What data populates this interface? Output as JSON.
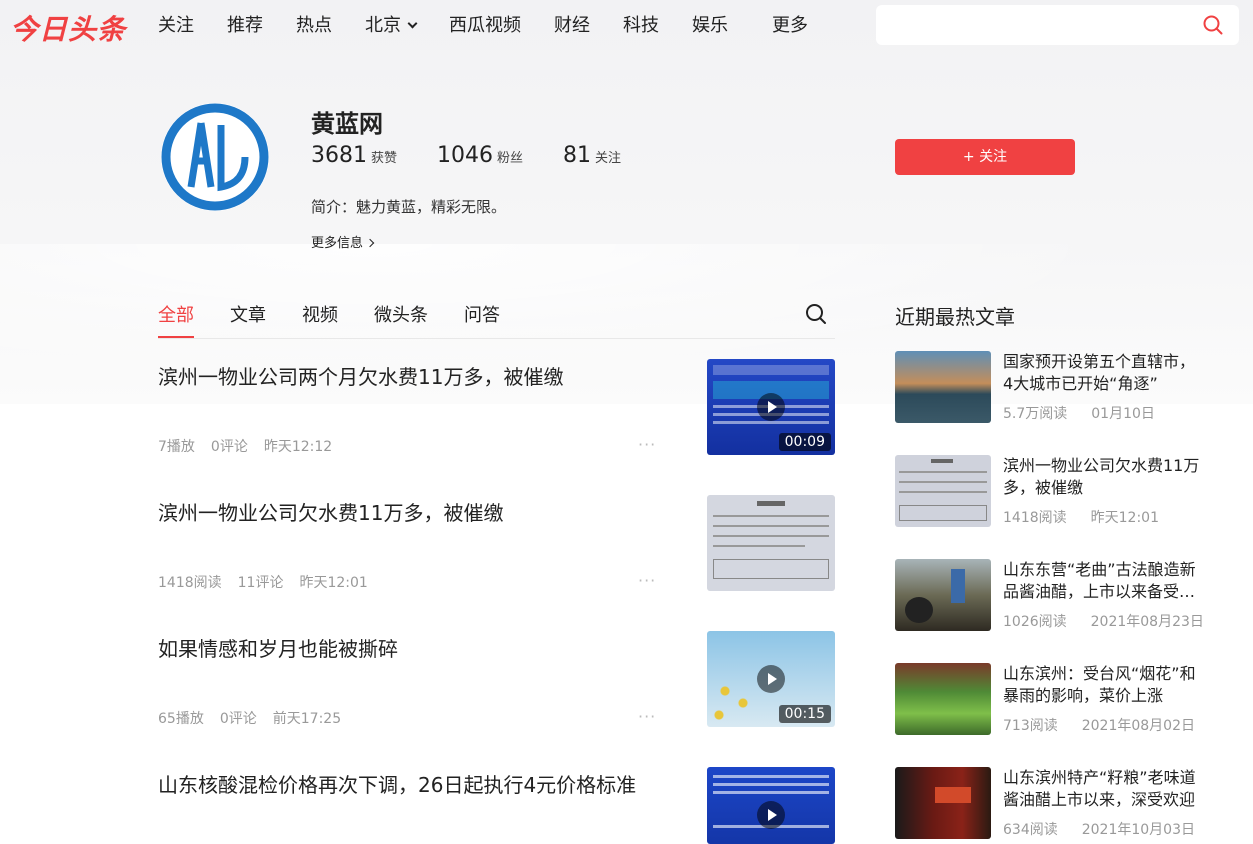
{
  "header": {
    "logo": "今日头条",
    "nav": [
      "关注",
      "推荐",
      "热点",
      "北京",
      "西瓜视频",
      "财经",
      "科技",
      "娱乐",
      "更多"
    ],
    "search_placeholder": ""
  },
  "profile": {
    "name": "黄蓝网",
    "stats": [
      {
        "value": "3681",
        "label": "获赞"
      },
      {
        "value": "1046",
        "label": "粉丝"
      },
      {
        "value": "81",
        "label": "关注"
      }
    ],
    "intro": "简介：魅力黄蓝，精彩无限。",
    "more_info": "更多信息",
    "follow_button": "+ 关注"
  },
  "tabs": [
    "全部",
    "文章",
    "视频",
    "微头条",
    "问答"
  ],
  "feed": [
    {
      "title": "滨州一物业公司两个月欠水费11万多，被催缴",
      "stat": "7播放",
      "comments": "0评论",
      "time": "昨天12:12",
      "duration": "00:09",
      "thumb_color": "#1c3fb5",
      "video": true
    },
    {
      "title": "滨州一物业公司欠水费11万多，被催缴",
      "stat": "1418阅读",
      "comments": "11评论",
      "time": "昨天12:01",
      "duration": "",
      "thumb_color": "#c9ccd6",
      "video": false
    },
    {
      "title": "如果情感和岁月也能被撕碎",
      "stat": "65播放",
      "comments": "0评论",
      "time": "前天17:25",
      "duration": "00:15",
      "thumb_color": "#7fb6d6",
      "video": true
    },
    {
      "title": "山东核酸混检价格再次下调，26日起执行4元价格标准",
      "stat": "",
      "comments": "",
      "time": "",
      "duration": "",
      "thumb_color": "#1a3fc0",
      "video": true
    }
  ],
  "sidebar": {
    "title": "近期最热文章",
    "items": [
      {
        "title": "国家预开设第五个直辖市，4大城市已开始“角逐”",
        "reads": "5.7万阅读",
        "date": "01月10日",
        "color": "#3a6a8a"
      },
      {
        "title": "滨州一物业公司欠水费11万多，被催缴",
        "reads": "1418阅读",
        "date": "昨天12:01",
        "color": "#c9ccd6"
      },
      {
        "title": "山东东营“老曲”古法酿造新品酱油醋，上市以来备受欢迎",
        "reads": "1026阅读",
        "date": "2021年08月23日",
        "color": "#6b6a55"
      },
      {
        "title": "山东滨州：受台风“烟花”和暴雨的影响，菜价上涨",
        "reads": "713阅读",
        "date": "2021年08月02日",
        "color": "#3f7a2e"
      },
      {
        "title": "山东滨州特产“籽粮”老味道酱油醋上市以来，深受欢迎",
        "reads": "634阅读",
        "date": "2021年10月03日",
        "color": "#5a1a14"
      }
    ]
  }
}
